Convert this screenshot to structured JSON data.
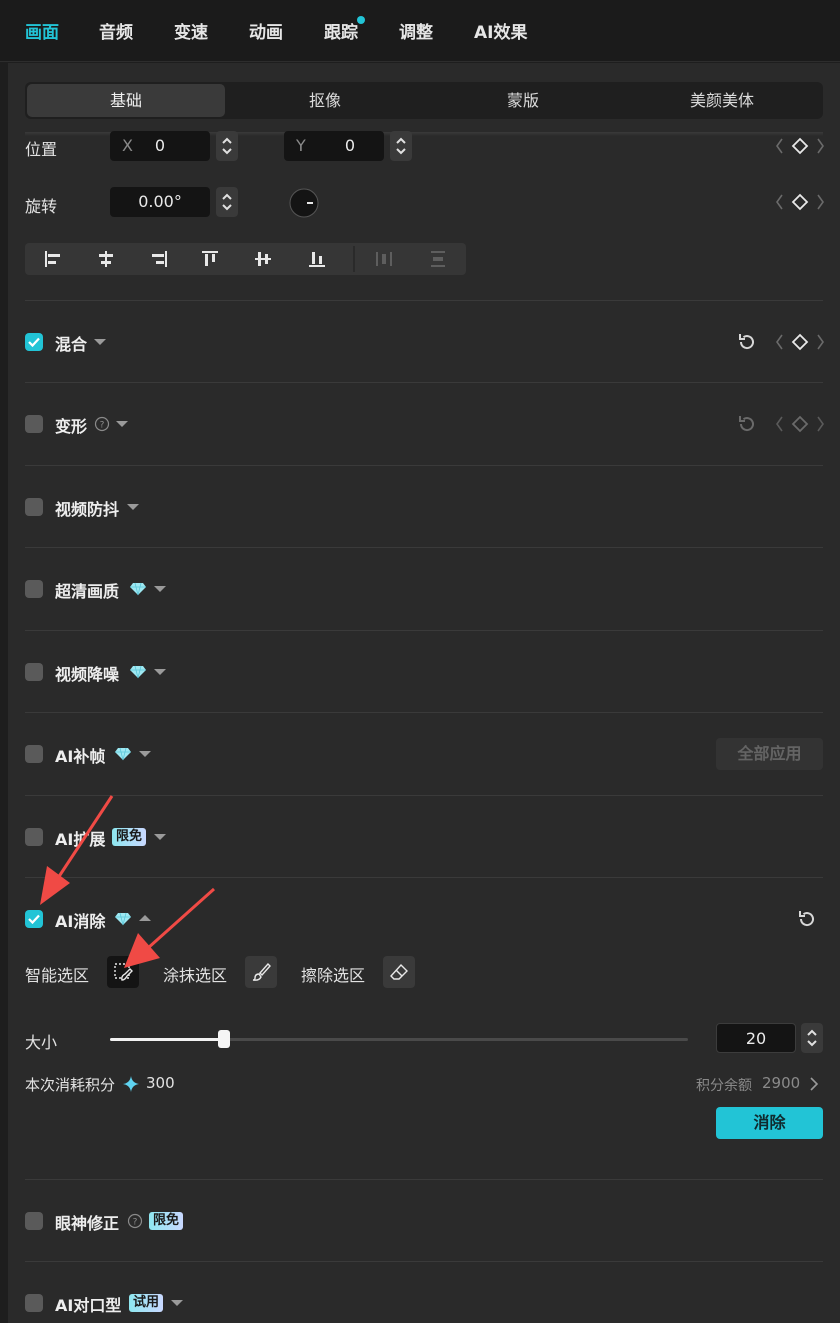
{
  "top_tabs": {
    "items": [
      {
        "label": "画面"
      },
      {
        "label": "音频"
      },
      {
        "label": "变速"
      },
      {
        "label": "动画"
      },
      {
        "label": "跟踪"
      },
      {
        "label": "调整"
      },
      {
        "label": "AI效果"
      }
    ],
    "active_index": 0,
    "notify_dot_tab": "跟踪"
  },
  "sub_tabs": {
    "items": [
      {
        "label": "基础"
      },
      {
        "label": "抠像"
      },
      {
        "label": "蒙版"
      },
      {
        "label": "美颜美体"
      }
    ],
    "active_index": 0
  },
  "transform": {
    "position_label": "位置",
    "x_label": "X",
    "x_value": "0",
    "y_label": "Y",
    "y_value": "0",
    "rotation_label": "旋转",
    "rotation_value": "0.00°"
  },
  "sections": {
    "blend": {
      "label": "混合",
      "checked": true
    },
    "deform": {
      "label": "变形",
      "checked": false
    },
    "stabilize": {
      "label": "视频防抖",
      "checked": false
    },
    "hd": {
      "label": "超清画质",
      "checked": false
    },
    "denoise": {
      "label": "视频降噪",
      "checked": false
    },
    "frame_interp": {
      "label": "AI补帧",
      "checked": false,
      "apply_all_label": "全部应用"
    },
    "ai_expand": {
      "label": "AI扩展",
      "checked": false,
      "badge": "限免"
    },
    "ai_erase": {
      "label": "AI消除",
      "checked": true
    },
    "eye_fix": {
      "label": "眼神修正",
      "checked": false,
      "badge": "限免"
    },
    "lip_sync": {
      "label": "AI对口型",
      "checked": false,
      "badge": "试用"
    }
  },
  "ai_erase": {
    "smart_select_label": "智能选区",
    "paint_select_label": "涂抹选区",
    "erase_select_label": "擦除选区",
    "size_label": "大小",
    "size_value": "20",
    "size_fraction": 0.198,
    "cost_label": "本次消耗积分",
    "cost_value": "300",
    "balance_label": "积分余额",
    "balance_value": "2900",
    "erase_button": "消除"
  },
  "colors": {
    "accent": "#22c4d6",
    "background": "#2a2a2a",
    "annotation_arrow": "#f04a45"
  },
  "icons": [
    "reset-icon",
    "keyframe-diamond-icon",
    "help-icon",
    "diamond-vip-icon",
    "sparkle-icon",
    "chevron-right-icon",
    "brush-icon",
    "eraser-icon",
    "smart-select-icon"
  ]
}
